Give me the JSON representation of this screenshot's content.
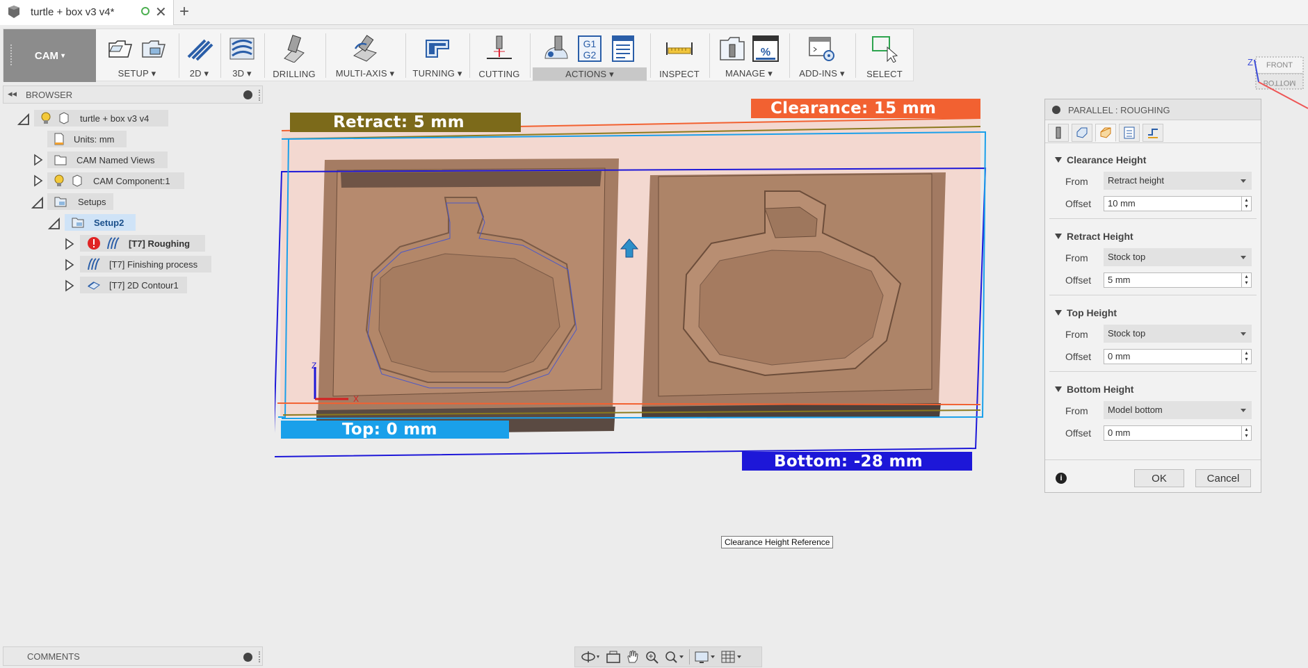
{
  "tab": {
    "title": "turtle + box v3 v4*",
    "new_tab_icon": "plus-icon"
  },
  "toolbar": {
    "workspace": "CAM",
    "groups": [
      {
        "label": "SETUP ▾"
      },
      {
        "label": "2D ▾"
      },
      {
        "label": "3D ▾"
      },
      {
        "label": "DRILLING"
      },
      {
        "label": "MULTI-AXIS ▾"
      },
      {
        "label": "TURNING ▾"
      },
      {
        "label": "CUTTING"
      },
      {
        "label": "ACTIONS ▾"
      },
      {
        "label": "INSPECT"
      },
      {
        "label": "MANAGE ▾"
      },
      {
        "label": "ADD-INS ▾"
      },
      {
        "label": "SELECT"
      }
    ],
    "gcode_icon_top": "G1",
    "gcode_icon_bottom": "G2",
    "percent_icon": "%"
  },
  "browser": {
    "title": "BROWSER",
    "root": "turtle + box v3 v4",
    "units": "Units: mm",
    "named_views": "CAM Named Views",
    "component": "CAM Component:1",
    "setups": "Setups",
    "setup": "Setup2",
    "ops": [
      {
        "label": "[T7] Roughing",
        "error": true
      },
      {
        "label": "[T7] Finishing process",
        "error": false
      },
      {
        "label": "[T7] 2D Contour1",
        "error": false
      }
    ]
  },
  "comments": {
    "title": "COMMENTS"
  },
  "viewport": {
    "clearance_label": "Clearance: 15 mm",
    "retract_label": "Retract: 5 mm",
    "top_label": "Top: 0 mm",
    "bottom_label": "Bottom: -28 mm",
    "axis_z": "Z",
    "axis_x": "X",
    "tooltip": "Clearance Height Reference",
    "colors": {
      "clearance": "#f26131",
      "retract": "#7c6a1a",
      "top": "#1aa0ea",
      "bottom": "#1d17d8",
      "stock": "#a57c63"
    }
  },
  "viewcube": {
    "front": "FRONT",
    "bottom": "BOTTOM",
    "axis": "Z"
  },
  "dialog": {
    "title": "PARALLEL : ROUGHING",
    "sections": [
      {
        "title": "Clearance Height",
        "from_label": "From",
        "from_value": "Retract height",
        "offset_label": "Offset",
        "offset_value": "10 mm"
      },
      {
        "title": "Retract Height",
        "from_label": "From",
        "from_value": "Stock top",
        "offset_label": "Offset",
        "offset_value": "5 mm"
      },
      {
        "title": "Top Height",
        "from_label": "From",
        "from_value": "Stock top",
        "offset_label": "Offset",
        "offset_value": "0 mm"
      },
      {
        "title": "Bottom Height",
        "from_label": "From",
        "from_value": "Model bottom",
        "offset_label": "Offset",
        "offset_value": "0 mm"
      }
    ],
    "ok": "OK",
    "cancel": "Cancel",
    "info_icon": "i"
  }
}
